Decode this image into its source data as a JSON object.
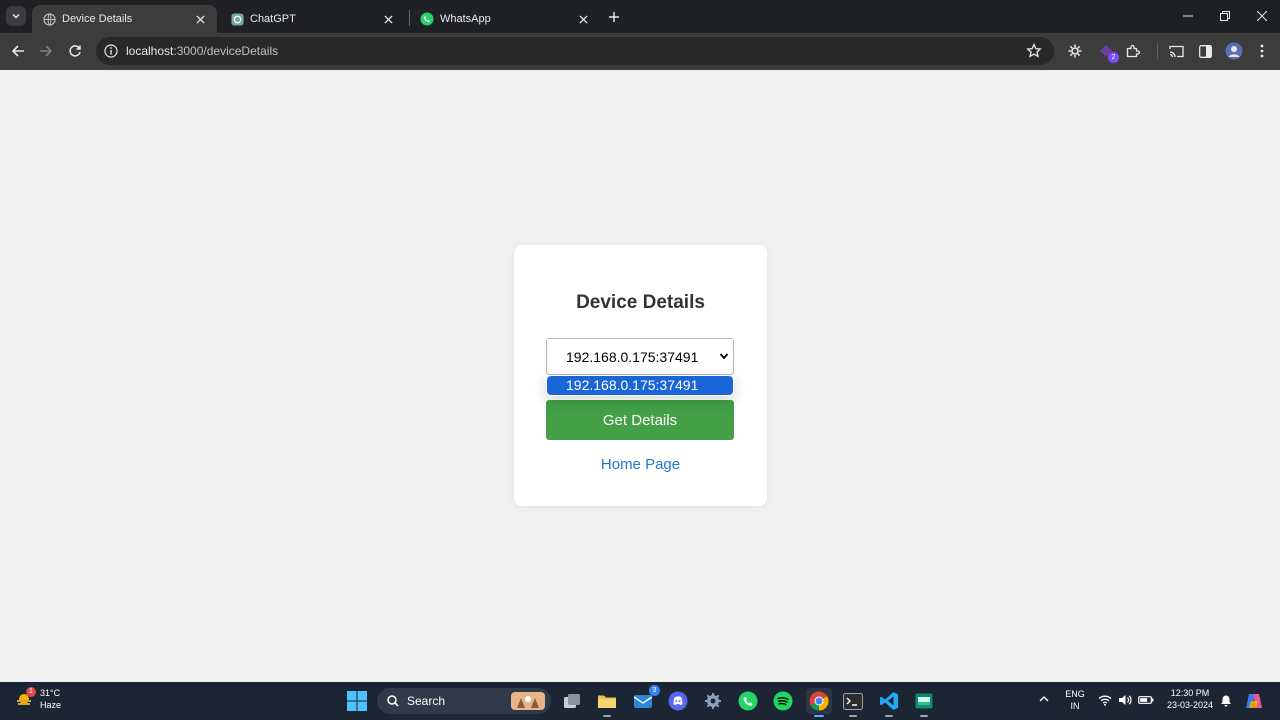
{
  "browser": {
    "tabs": [
      {
        "title": "Device Details",
        "active": true
      },
      {
        "title": "ChatGPT",
        "active": false
      },
      {
        "title": "WhatsApp",
        "active": false
      }
    ],
    "url_host": "localhost",
    "url_path": ":3000/deviceDetails",
    "extension_badge": "2"
  },
  "page": {
    "title": "Device Details",
    "select_value": "192.168.0.175:37491",
    "options": [
      "192.168.0.175:37491"
    ],
    "button_label": "Get Details",
    "link_label": "Home Page",
    "colors": {
      "button": "#43a047",
      "link": "#1f7ad0",
      "option_highlight": "#1a66d9"
    }
  },
  "taskbar": {
    "weather_temp": "31°C",
    "weather_condition": "Haze",
    "weather_badge": "1",
    "search_placeholder": "Search",
    "mail_badge": "3",
    "lang_top": "ENG",
    "lang_bottom": "IN",
    "time": "12:30 PM",
    "date": "23-03-2024"
  }
}
